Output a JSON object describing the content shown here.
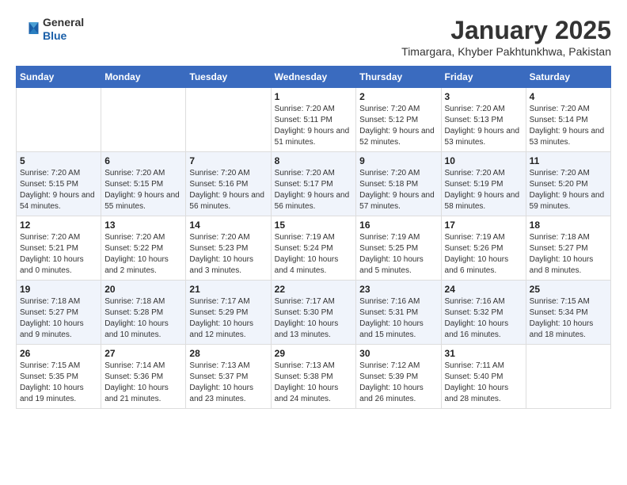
{
  "header": {
    "logo_general": "General",
    "logo_blue": "Blue",
    "title": "January 2025",
    "subtitle": "Timargara, Khyber Pakhtunkhwa, Pakistan"
  },
  "weekdays": [
    "Sunday",
    "Monday",
    "Tuesday",
    "Wednesday",
    "Thursday",
    "Friday",
    "Saturday"
  ],
  "weeks": [
    [
      {
        "day": "",
        "sunrise": "",
        "sunset": "",
        "daylight": ""
      },
      {
        "day": "",
        "sunrise": "",
        "sunset": "",
        "daylight": ""
      },
      {
        "day": "",
        "sunrise": "",
        "sunset": "",
        "daylight": ""
      },
      {
        "day": "1",
        "sunrise": "Sunrise: 7:20 AM",
        "sunset": "Sunset: 5:11 PM",
        "daylight": "Daylight: 9 hours and 51 minutes."
      },
      {
        "day": "2",
        "sunrise": "Sunrise: 7:20 AM",
        "sunset": "Sunset: 5:12 PM",
        "daylight": "Daylight: 9 hours and 52 minutes."
      },
      {
        "day": "3",
        "sunrise": "Sunrise: 7:20 AM",
        "sunset": "Sunset: 5:13 PM",
        "daylight": "Daylight: 9 hours and 53 minutes."
      },
      {
        "day": "4",
        "sunrise": "Sunrise: 7:20 AM",
        "sunset": "Sunset: 5:14 PM",
        "daylight": "Daylight: 9 hours and 53 minutes."
      }
    ],
    [
      {
        "day": "5",
        "sunrise": "Sunrise: 7:20 AM",
        "sunset": "Sunset: 5:15 PM",
        "daylight": "Daylight: 9 hours and 54 minutes."
      },
      {
        "day": "6",
        "sunrise": "Sunrise: 7:20 AM",
        "sunset": "Sunset: 5:15 PM",
        "daylight": "Daylight: 9 hours and 55 minutes."
      },
      {
        "day": "7",
        "sunrise": "Sunrise: 7:20 AM",
        "sunset": "Sunset: 5:16 PM",
        "daylight": "Daylight: 9 hours and 56 minutes."
      },
      {
        "day": "8",
        "sunrise": "Sunrise: 7:20 AM",
        "sunset": "Sunset: 5:17 PM",
        "daylight": "Daylight: 9 hours and 56 minutes."
      },
      {
        "day": "9",
        "sunrise": "Sunrise: 7:20 AM",
        "sunset": "Sunset: 5:18 PM",
        "daylight": "Daylight: 9 hours and 57 minutes."
      },
      {
        "day": "10",
        "sunrise": "Sunrise: 7:20 AM",
        "sunset": "Sunset: 5:19 PM",
        "daylight": "Daylight: 9 hours and 58 minutes."
      },
      {
        "day": "11",
        "sunrise": "Sunrise: 7:20 AM",
        "sunset": "Sunset: 5:20 PM",
        "daylight": "Daylight: 9 hours and 59 minutes."
      }
    ],
    [
      {
        "day": "12",
        "sunrise": "Sunrise: 7:20 AM",
        "sunset": "Sunset: 5:21 PM",
        "daylight": "Daylight: 10 hours and 0 minutes."
      },
      {
        "day": "13",
        "sunrise": "Sunrise: 7:20 AM",
        "sunset": "Sunset: 5:22 PM",
        "daylight": "Daylight: 10 hours and 2 minutes."
      },
      {
        "day": "14",
        "sunrise": "Sunrise: 7:20 AM",
        "sunset": "Sunset: 5:23 PM",
        "daylight": "Daylight: 10 hours and 3 minutes."
      },
      {
        "day": "15",
        "sunrise": "Sunrise: 7:19 AM",
        "sunset": "Sunset: 5:24 PM",
        "daylight": "Daylight: 10 hours and 4 minutes."
      },
      {
        "day": "16",
        "sunrise": "Sunrise: 7:19 AM",
        "sunset": "Sunset: 5:25 PM",
        "daylight": "Daylight: 10 hours and 5 minutes."
      },
      {
        "day": "17",
        "sunrise": "Sunrise: 7:19 AM",
        "sunset": "Sunset: 5:26 PM",
        "daylight": "Daylight: 10 hours and 6 minutes."
      },
      {
        "day": "18",
        "sunrise": "Sunrise: 7:18 AM",
        "sunset": "Sunset: 5:27 PM",
        "daylight": "Daylight: 10 hours and 8 minutes."
      }
    ],
    [
      {
        "day": "19",
        "sunrise": "Sunrise: 7:18 AM",
        "sunset": "Sunset: 5:27 PM",
        "daylight": "Daylight: 10 hours and 9 minutes."
      },
      {
        "day": "20",
        "sunrise": "Sunrise: 7:18 AM",
        "sunset": "Sunset: 5:28 PM",
        "daylight": "Daylight: 10 hours and 10 minutes."
      },
      {
        "day": "21",
        "sunrise": "Sunrise: 7:17 AM",
        "sunset": "Sunset: 5:29 PM",
        "daylight": "Daylight: 10 hours and 12 minutes."
      },
      {
        "day": "22",
        "sunrise": "Sunrise: 7:17 AM",
        "sunset": "Sunset: 5:30 PM",
        "daylight": "Daylight: 10 hours and 13 minutes."
      },
      {
        "day": "23",
        "sunrise": "Sunrise: 7:16 AM",
        "sunset": "Sunset: 5:31 PM",
        "daylight": "Daylight: 10 hours and 15 minutes."
      },
      {
        "day": "24",
        "sunrise": "Sunrise: 7:16 AM",
        "sunset": "Sunset: 5:32 PM",
        "daylight": "Daylight: 10 hours and 16 minutes."
      },
      {
        "day": "25",
        "sunrise": "Sunrise: 7:15 AM",
        "sunset": "Sunset: 5:34 PM",
        "daylight": "Daylight: 10 hours and 18 minutes."
      }
    ],
    [
      {
        "day": "26",
        "sunrise": "Sunrise: 7:15 AM",
        "sunset": "Sunset: 5:35 PM",
        "daylight": "Daylight: 10 hours and 19 minutes."
      },
      {
        "day": "27",
        "sunrise": "Sunrise: 7:14 AM",
        "sunset": "Sunset: 5:36 PM",
        "daylight": "Daylight: 10 hours and 21 minutes."
      },
      {
        "day": "28",
        "sunrise": "Sunrise: 7:13 AM",
        "sunset": "Sunset: 5:37 PM",
        "daylight": "Daylight: 10 hours and 23 minutes."
      },
      {
        "day": "29",
        "sunrise": "Sunrise: 7:13 AM",
        "sunset": "Sunset: 5:38 PM",
        "daylight": "Daylight: 10 hours and 24 minutes."
      },
      {
        "day": "30",
        "sunrise": "Sunrise: 7:12 AM",
        "sunset": "Sunset: 5:39 PM",
        "daylight": "Daylight: 10 hours and 26 minutes."
      },
      {
        "day": "31",
        "sunrise": "Sunrise: 7:11 AM",
        "sunset": "Sunset: 5:40 PM",
        "daylight": "Daylight: 10 hours and 28 minutes."
      },
      {
        "day": "",
        "sunrise": "",
        "sunset": "",
        "daylight": ""
      }
    ]
  ]
}
